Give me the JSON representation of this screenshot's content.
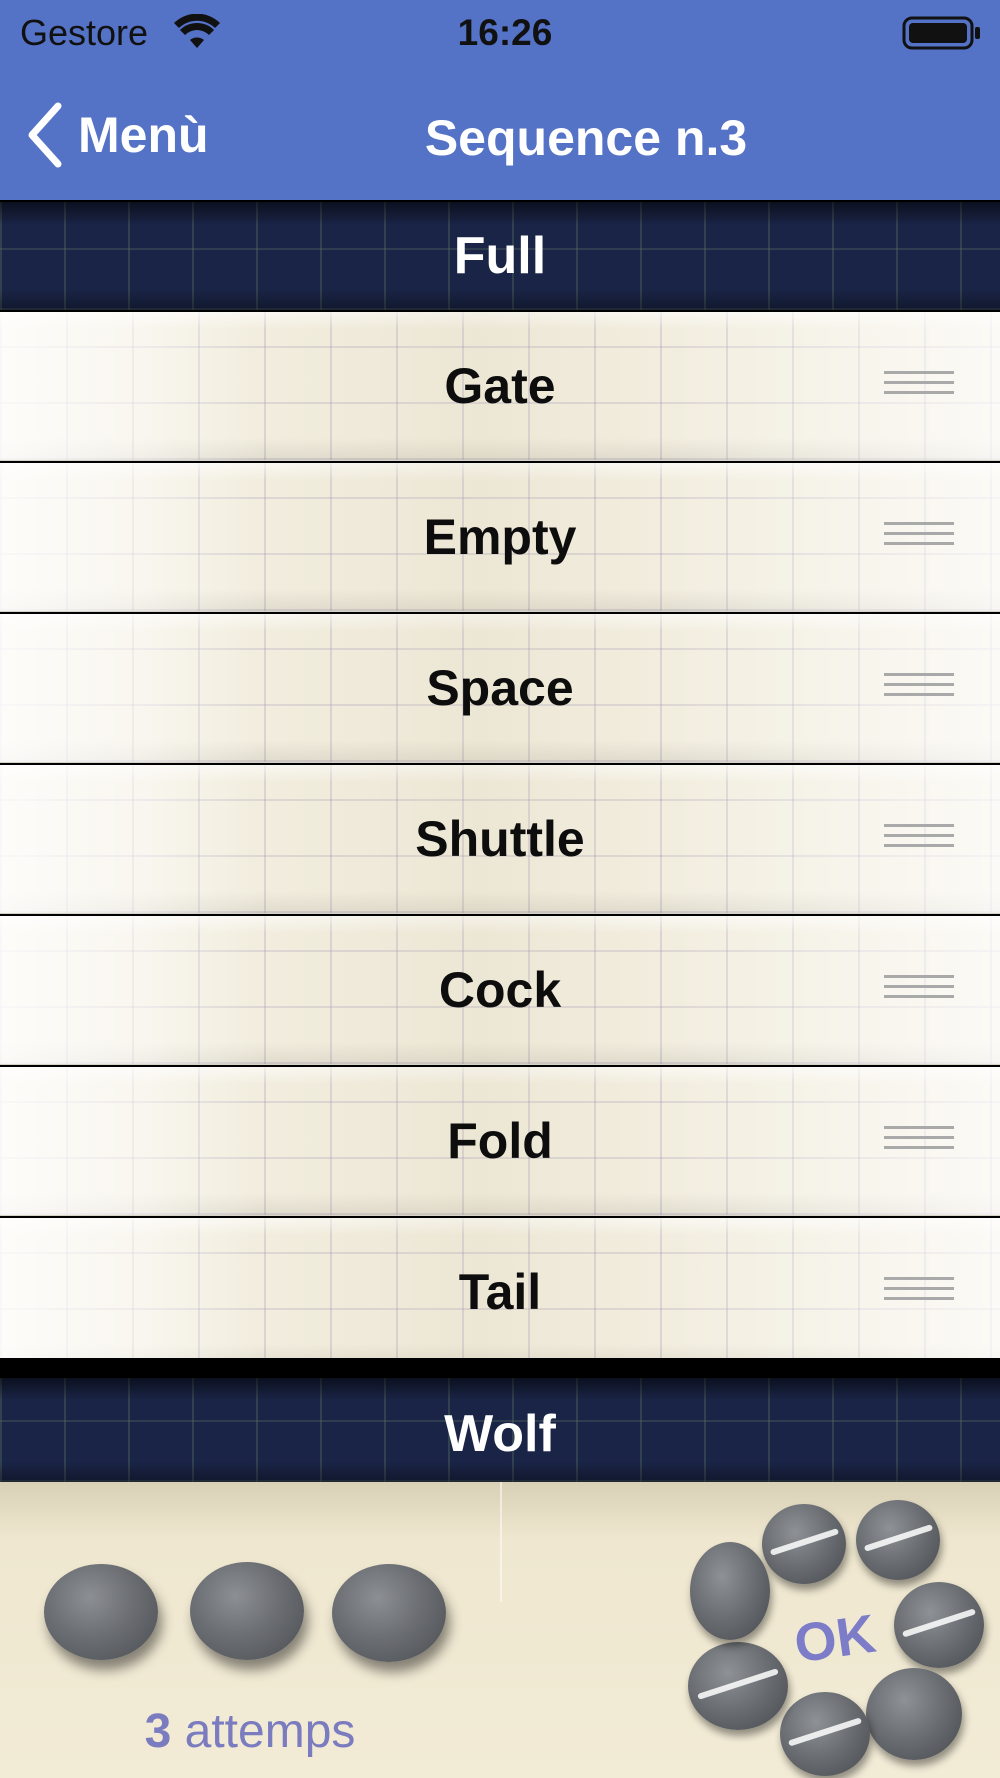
{
  "status_bar": {
    "carrier": "Gestore",
    "time": "16:26",
    "icons": [
      "wifi-icon",
      "battery-icon"
    ]
  },
  "nav": {
    "back_label": "Menù",
    "title": "Sequence n.3"
  },
  "sequence": {
    "start_word": "Full",
    "words": [
      "Gate",
      "Empty",
      "Space",
      "Shuttle",
      "Cock",
      "Fold",
      "Tail"
    ],
    "end_word": "Wolf"
  },
  "attempts": {
    "count": "3",
    "label": "attemps",
    "stones_remaining": 3
  },
  "ok_button": {
    "label": "OK"
  },
  "colors": {
    "nav_background": "#5472c6",
    "attempts_text": "#7b7bc0",
    "ok_text": "#7c7cc8"
  }
}
